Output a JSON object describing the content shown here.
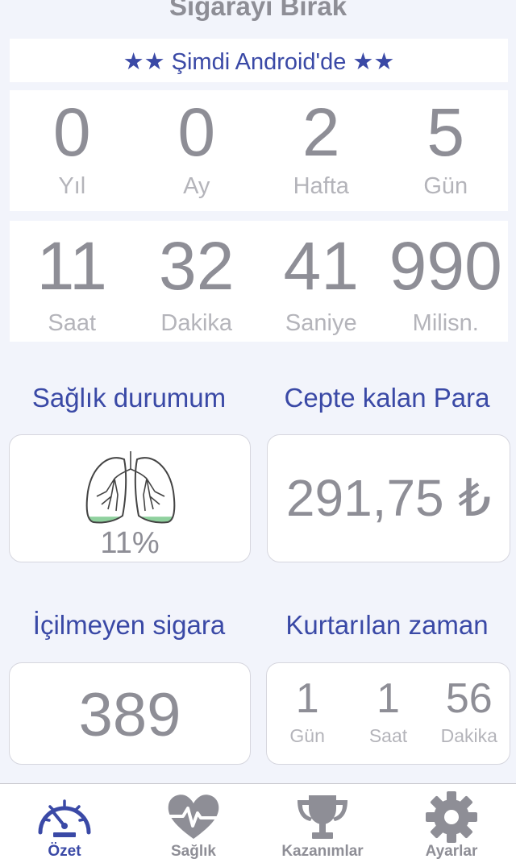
{
  "app": {
    "title": "Sigarayı Bırak",
    "promo": "★★ Şimdi Android'de ★★"
  },
  "timer": {
    "row1": [
      {
        "value": "0",
        "label": "Yıl"
      },
      {
        "value": "0",
        "label": "Ay"
      },
      {
        "value": "2",
        "label": "Hafta"
      },
      {
        "value": "5",
        "label": "Gün"
      }
    ],
    "row2": [
      {
        "value": "11",
        "label": "Saat"
      },
      {
        "value": "32",
        "label": "Dakika"
      },
      {
        "value": "41",
        "label": "Saniye"
      },
      {
        "value": "990",
        "label": "Milisn."
      }
    ]
  },
  "health": {
    "title": "Sağlık durumum",
    "percent_text": "11%",
    "percent": 11
  },
  "money": {
    "title": "Cepte kalan Para",
    "value": "291,75 ₺"
  },
  "cigarettes": {
    "title": "İçilmeyen sigara",
    "value": "389"
  },
  "saved_time": {
    "title": "Kurtarılan zaman",
    "items": [
      {
        "value": "1",
        "label": "Gün"
      },
      {
        "value": "1",
        "label": "Saat"
      },
      {
        "value": "56",
        "label": "Dakika"
      }
    ]
  },
  "tabs": [
    {
      "label": "Özet",
      "icon": "speedometer-icon",
      "active": true
    },
    {
      "label": "Sağlık",
      "icon": "heartbeat-icon",
      "active": false
    },
    {
      "label": "Kazanımlar",
      "icon": "trophy-icon",
      "active": false
    },
    {
      "label": "Ayarlar",
      "icon": "gear-icon",
      "active": false
    }
  ],
  "colors": {
    "accent": "#3a49a6",
    "text_gray": "#8e8e96",
    "label_gray": "#b4b4ba",
    "background": "#f2f4fb",
    "lung_fill": "#8fd19e"
  }
}
